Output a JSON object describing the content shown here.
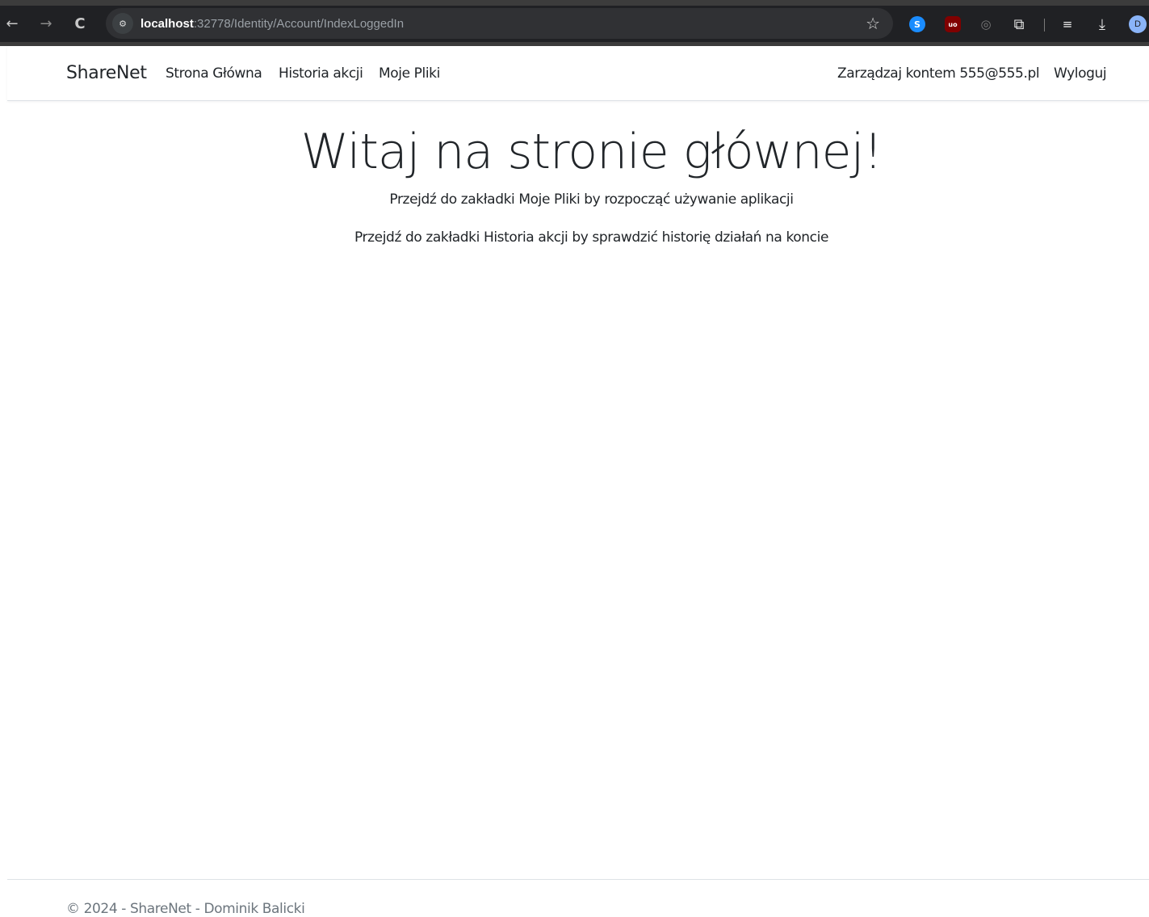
{
  "browser": {
    "back_icon": "←",
    "forward_icon": "→",
    "reload_icon": "C",
    "site_info_icon": "⚙",
    "url_host": "localhost",
    "url_path": ":32778/Identity/Account/IndexLoggedIn",
    "bookmark_icon": "☆",
    "extensions": {
      "ext1_icon": "S",
      "ext2_icon": "uo",
      "ext3_icon": "◎",
      "puzzle_icon": "⧉",
      "media_icon": "≡",
      "download_icon": "⤓"
    },
    "profile_initial": "D",
    "colors": {
      "toolbar": "#202124",
      "omnibox": "#303134"
    }
  },
  "navbar": {
    "brand": "ShareNet",
    "links": {
      "home": "Strona Główna",
      "history": "Historia akcji",
      "files": "Moje Pliki"
    },
    "manage_account": "Zarządzaj kontem 555@555.pl",
    "logout": "Wyloguj"
  },
  "main": {
    "title": "Witaj na stronie głównej!",
    "line1": "Przejdź do zakładki Moje Pliki by rozpocząć używanie aplikacji",
    "line2": "Przejdź do zakładki Historia akcji by sprawdzić historię działań na koncie"
  },
  "footer": {
    "text": "© 2024 - ShareNet - Dominik Balicki"
  }
}
